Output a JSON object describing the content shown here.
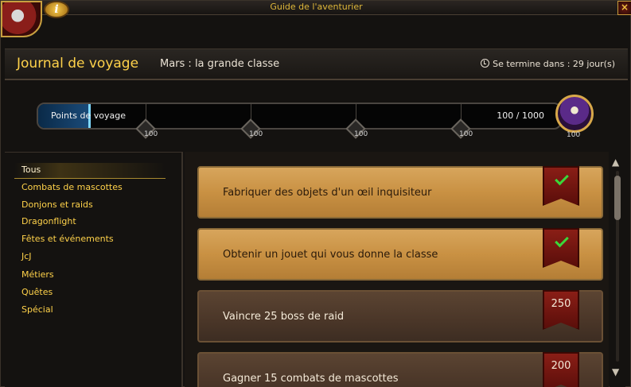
{
  "window": {
    "title": "Guide de l'aventurier",
    "close_label": "×",
    "info_label": "i"
  },
  "header": {
    "journal_title": "Journal de voyage",
    "month_title": "Mars : la grande classe",
    "ends_text": "Se termine dans : 29 jour(s)"
  },
  "progress": {
    "label": "Points de voyage",
    "current": 100,
    "max": 1000,
    "value_text": "100 / 1000",
    "milestones": [
      "100",
      "100",
      "100",
      "100",
      "100"
    ]
  },
  "sidebar": {
    "items": [
      {
        "label": "Tous",
        "active": true
      },
      {
        "label": "Combats de mascottes",
        "active": false
      },
      {
        "label": "Donjons et raids",
        "active": false
      },
      {
        "label": "Dragonflight",
        "active": false
      },
      {
        "label": "Fêtes et événements",
        "active": false
      },
      {
        "label": "JcJ",
        "active": false
      },
      {
        "label": "Métiers",
        "active": false
      },
      {
        "label": "Quêtes",
        "active": false
      },
      {
        "label": "Spécial",
        "active": false
      }
    ]
  },
  "tasks": [
    {
      "text": "Fabriquer des objets d'un œil inquisiteur",
      "completed": true,
      "reward": ""
    },
    {
      "text": "Obtenir un jouet qui vous donne la classe",
      "completed": true,
      "reward": ""
    },
    {
      "text": "Vaincre 25 boss de raid",
      "completed": false,
      "reward": "250"
    },
    {
      "text": "Gagner 15 combats de mascottes",
      "completed": false,
      "reward": "200"
    }
  ],
  "colors": {
    "accent_gold": "#ffd24a",
    "progress_fill": "#1a4a78",
    "check_green": "#3ad83a",
    "banner_red": "#8a1e16"
  }
}
